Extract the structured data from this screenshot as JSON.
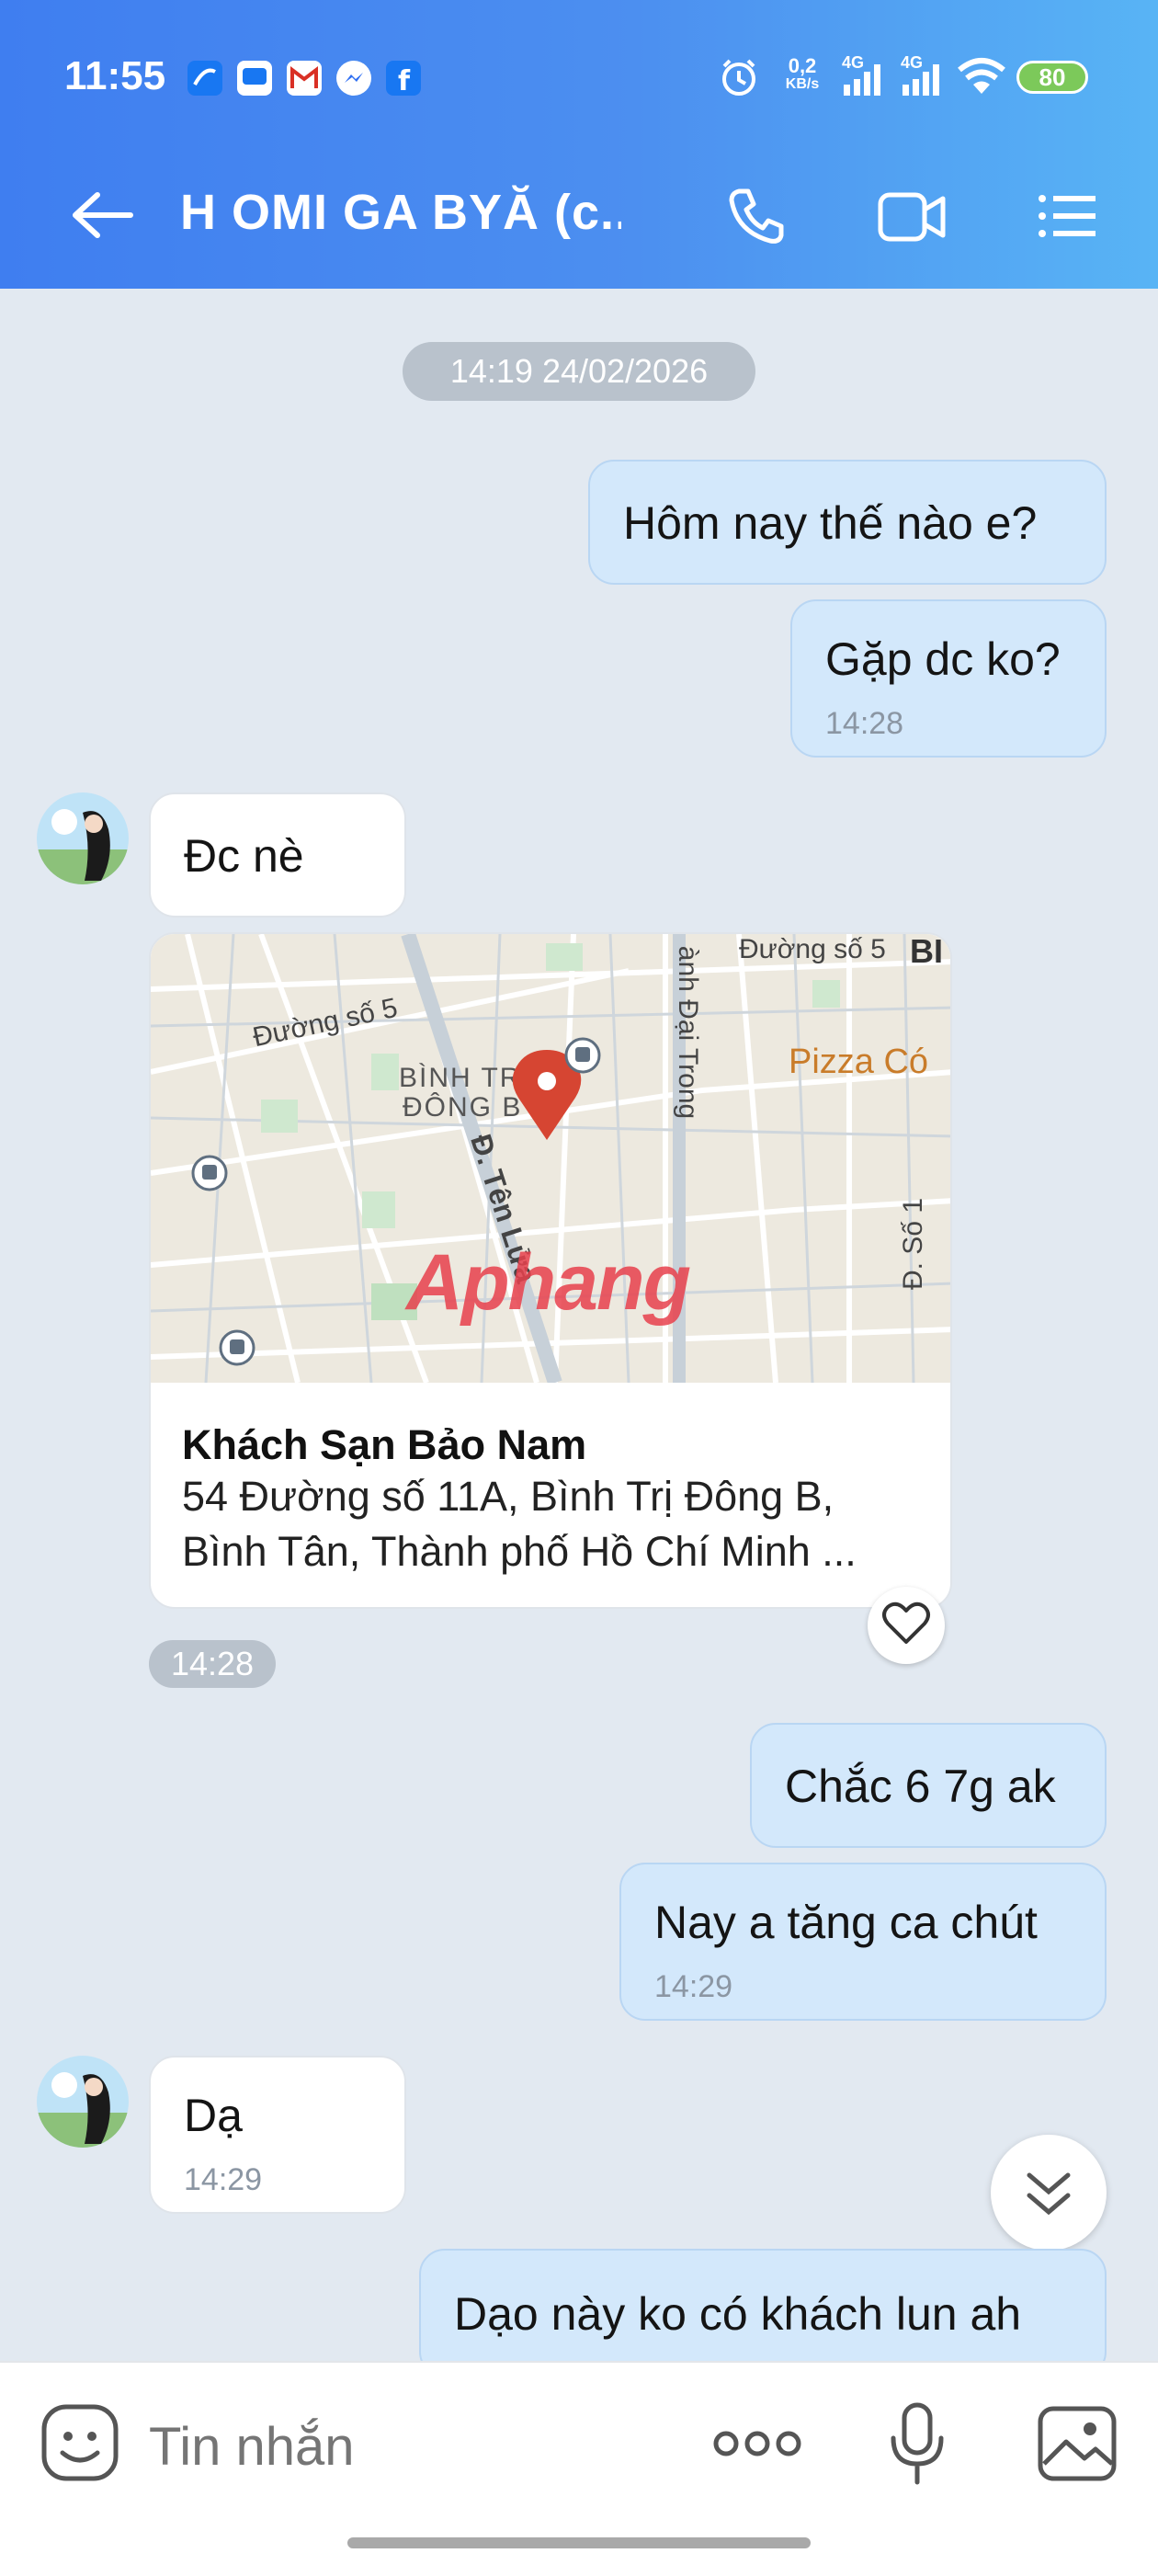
{
  "status_bar": {
    "time": "11:55",
    "net_speed_value": "0,2",
    "net_speed_unit": "KB/s",
    "sim1": "4G",
    "sim2": "4G",
    "battery": "80"
  },
  "header": {
    "title": "H OMI GA BYĂ (c..."
  },
  "chat": {
    "date_separator": "14:19 24/02/2026",
    "messages": [
      {
        "text": "Hôm nay thế nào e?"
      },
      {
        "text": "Gặp dc ko?",
        "time": "14:28"
      },
      {
        "text": "Đc nè"
      },
      {
        "text": "Chắc 6 7g ak"
      },
      {
        "text": "Nay a tăng ca chút",
        "time": "14:29"
      },
      {
        "text": "Dạ",
        "time": "14:29"
      },
      {
        "text": "Dạo này ko có khách lun ah"
      }
    ],
    "location": {
      "name": "Khách Sạn Bảo Nam",
      "address_line1": "54 Đường số 11A, Bình Trị Đông B,",
      "address_line2": "Bình Tân, Thành phố Hồ Chí Minh ...",
      "time": "14:28",
      "map_labels": {
        "street1": "Đường số 5",
        "street2": "Đường số 5",
        "ward_line1": "BÌNH TR",
        "ward_line2": "ĐÔNG B",
        "road_vertical": "Đ. Tên Lửa",
        "road_right": "ành Đại Trong",
        "poi": "Pizza Có",
        "so1": "Đ. Số 1",
        "edge": "BI",
        "watermark": "Aphang"
      }
    }
  },
  "input": {
    "placeholder": "Tin nhắn"
  },
  "colors": {
    "header_start": "#3f7ef0",
    "header_end": "#58b4f5",
    "outgoing_bubble": "#d3e8fb",
    "incoming_bubble": "#ffffff",
    "chat_background": "#e2e9f1",
    "map_pin": "#d64532"
  }
}
